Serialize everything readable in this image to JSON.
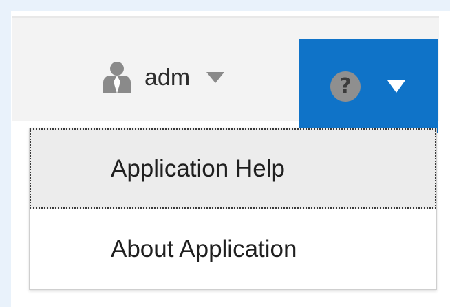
{
  "header": {
    "user": {
      "name": "adm",
      "icon": "user-icon",
      "caret_icon": "caret-down-icon",
      "caret_color": "#8a8a8a"
    },
    "help": {
      "icon": "help-icon",
      "glyph": "?",
      "caret_icon": "caret-down-icon",
      "background": "#0f73c8"
    }
  },
  "help_menu": {
    "items": [
      {
        "label": "Application Help",
        "focused": true
      },
      {
        "label": "About Application",
        "focused": false
      }
    ]
  }
}
